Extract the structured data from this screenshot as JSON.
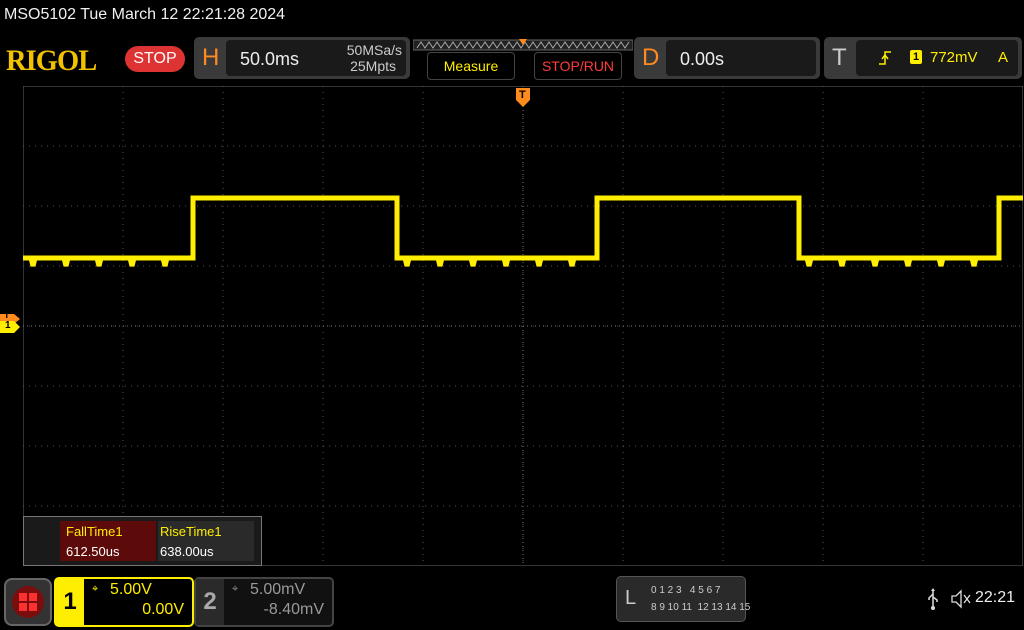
{
  "window": {
    "title": "MSO5102  Tue March 12 22:21:28 2024"
  },
  "toolbar": {
    "logo": "RIGOL",
    "run_state": "STOP",
    "horizontal": {
      "letter": "H",
      "timebase": "50.0ms",
      "sample_rate": "50MSa/s",
      "memory_depth": "25Mpts"
    },
    "measure_label": "Measure",
    "stoprun_label": "STOP/RUN",
    "delay": {
      "letter": "D",
      "value": "0.00s"
    },
    "trigger": {
      "letter": "T",
      "source": "1",
      "level": "772mV",
      "mode": "A"
    }
  },
  "markers": {
    "trigger_pos": "T",
    "ch1_level": "T",
    "ch1_num": "1"
  },
  "measurements": [
    {
      "name": "FallTime1",
      "value": "612.50us"
    },
    {
      "name": "RiseTime1",
      "value": "638.00us"
    }
  ],
  "channels": [
    {
      "num": "1",
      "scale": "5.00V",
      "offset": "0.00V",
      "coupling_icon": "dc-coupling-icon"
    },
    {
      "num": "2",
      "scale": "5.00mV",
      "offset": "-8.40mV",
      "coupling_icon": "dc-coupling-icon"
    }
  ],
  "logic": {
    "letter": "L",
    "row1": "0 1 2 3   4 5 6 7",
    "row2": "8 9 10 11  12 13 14 15"
  },
  "status": {
    "time": "22:21"
  },
  "colors": {
    "ch1": "#ffee00",
    "stop": "#dd3333",
    "accent": "#ff8a1e",
    "grid": "#555555"
  }
}
